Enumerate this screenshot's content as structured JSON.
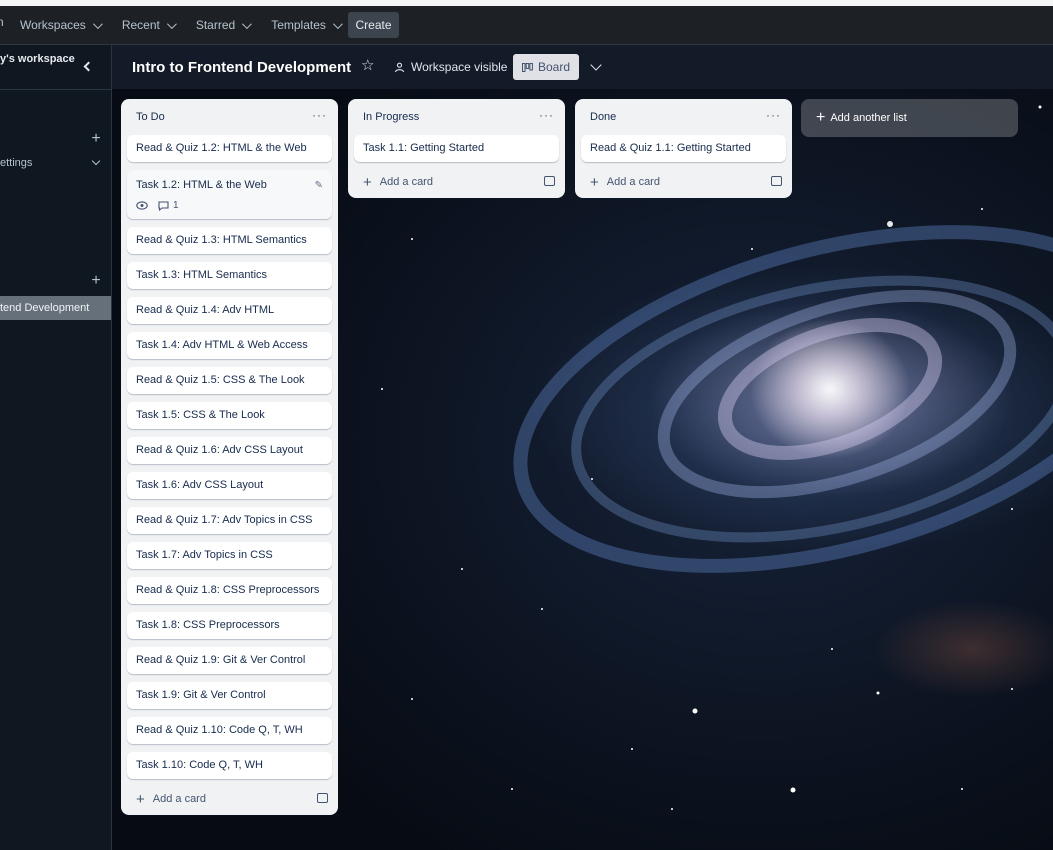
{
  "topnav": {
    "first_item": "n",
    "items": [
      {
        "label": "Workspaces"
      },
      {
        "label": "Recent"
      },
      {
        "label": "Starred"
      },
      {
        "label": "Templates"
      }
    ],
    "create_label": "Create"
  },
  "sidebar": {
    "workspace_name": "y's workspace",
    "settings_label": "ettings",
    "active_board": "tend Development"
  },
  "board": {
    "title": "Intro to Frontend Development",
    "visibility": "Workspace visible",
    "view_label": "Board"
  },
  "lists": [
    {
      "title": "To Do",
      "add_card": "Add a card",
      "cards": [
        {
          "title": "Read & Quiz 1.2: HTML & the Web"
        },
        {
          "title": "Task 1.2: HTML & the Web",
          "comments": "1"
        },
        {
          "title": "Read & Quiz 1.3: HTML Semantics"
        },
        {
          "title": "Task 1.3: HTML Semantics"
        },
        {
          "title": "Read & Quiz 1.4: Adv HTML"
        },
        {
          "title": "Task 1.4: Adv HTML & Web Access"
        },
        {
          "title": "Read & Quiz 1.5: CSS & The Look"
        },
        {
          "title": "Task 1.5: CSS & The Look"
        },
        {
          "title": "Read & Quiz 1.6: Adv CSS Layout"
        },
        {
          "title": "Task 1.6: Adv CSS Layout"
        },
        {
          "title": "Read & Quiz 1.7: Adv Topics in CSS"
        },
        {
          "title": "Task 1.7: Adv Topics in CSS"
        },
        {
          "title": "Read & Quiz 1.8: CSS Preprocessors"
        },
        {
          "title": "Task 1.8: CSS Preprocessors"
        },
        {
          "title": "Read & Quiz 1.9: Git & Ver Control"
        },
        {
          "title": "Task 1.9: Git & Ver Control"
        },
        {
          "title": "Read & Quiz 1.10: Code Q, T, WH"
        },
        {
          "title": "Task 1.10: Code Q, T, WH"
        }
      ]
    },
    {
      "title": "In Progress",
      "add_card": "Add a card",
      "cards": [
        {
          "title": "Task 1.1: Getting Started"
        }
      ]
    },
    {
      "title": "Done",
      "add_card": "Add a card",
      "cards": [
        {
          "title": "Read & Quiz 1.1: Getting Started"
        }
      ]
    }
  ],
  "add_list_label": "Add another list",
  "colors": {
    "nav_bg": "#1d2125",
    "list_bg": "#f1f2f4",
    "card_bg": "#ffffff",
    "board_btn_bg": "#dfe1e6"
  }
}
